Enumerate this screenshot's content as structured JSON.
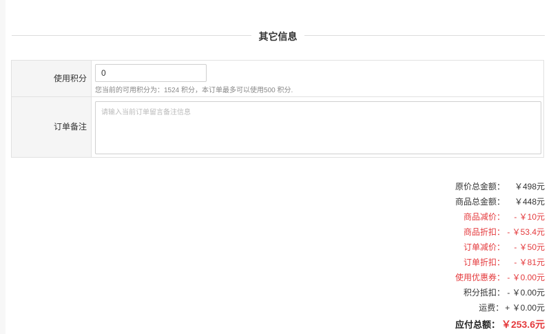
{
  "section": {
    "title": "其它信息"
  },
  "form": {
    "points_label": "使用积分",
    "points_value": "0",
    "points_hint": "您当前的可用积分为：1524 积分，本订单最多可以使用500 积分.",
    "remark_label": "订单备注",
    "remark_placeholder": "请输入当前订单留言备注信息"
  },
  "summary": {
    "rows": [
      {
        "label": "原价总金额：",
        "value": "￥498元",
        "style": "normal"
      },
      {
        "label": "商品总金额：",
        "value": "￥448元",
        "style": "normal"
      },
      {
        "label": "商品减价：",
        "value": "- ￥10元",
        "style": "red"
      },
      {
        "label": "商品折扣：",
        "value": "- ￥53.4元",
        "style": "red"
      },
      {
        "label": "订单减价：",
        "value": "- ￥50元",
        "style": "red"
      },
      {
        "label": "订单折扣：",
        "value": "- ￥81元",
        "style": "red"
      },
      {
        "label": "使用优惠券：",
        "value": "- ￥0.00元",
        "style": "red"
      },
      {
        "label": "积分抵扣：",
        "value": "- ￥0.00元",
        "style": "normal"
      },
      {
        "label": "运费：",
        "value": "+ ￥0.00元",
        "style": "normal"
      }
    ],
    "total_label": "应付总额：",
    "total_value": "￥253.6元"
  },
  "colors": {
    "accent_red": "#e4393c",
    "label_bg": "#f5f5f5",
    "border": "#e1e1e1"
  }
}
